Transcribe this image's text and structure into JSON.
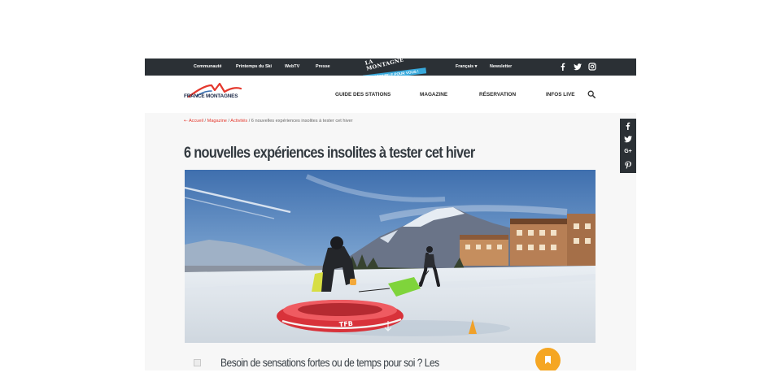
{
  "topbar": {
    "links": [
      "Communauté",
      "Printemps du Ski",
      "WebTV",
      "Presse"
    ],
    "promo_stamp_line1": "LA",
    "promo_stamp_line2": "MONTAGNE",
    "promo_ribbon": "DISPONIBLE POUR VOUS !",
    "language": "Français ▾",
    "newsletter": "Newsletter",
    "social_icons": [
      "facebook-icon",
      "twitter-icon",
      "instagram-icon"
    ]
  },
  "header": {
    "logo_text": "FRANCE MONTAGNES",
    "nav": [
      "GUIDE DES STATIONS",
      "MAGAZINE",
      "RÉSERVATION",
      "INFOS LIVE"
    ]
  },
  "breadcrumb": {
    "home": "Accueil",
    "items": [
      "Magazine",
      "Activités"
    ],
    "current": "6 nouvelles expériences insolites à tester cet hiver"
  },
  "article": {
    "title": "6 nouvelles expériences insolites à tester cet hiver",
    "intro": "Besoin de sensations fortes ou de temps pour soi ? Les"
  },
  "sharebar": {
    "icons": [
      "facebook-icon",
      "twitter-icon",
      "google-plus-icon",
      "pinterest-icon"
    ],
    "gplus_label": "G+"
  },
  "colors": {
    "topbar_bg": "#2b3035",
    "accent_red": "#e4372c",
    "ribbon_blue": "#38a9dc",
    "bookmark_orange": "#f5a623"
  }
}
